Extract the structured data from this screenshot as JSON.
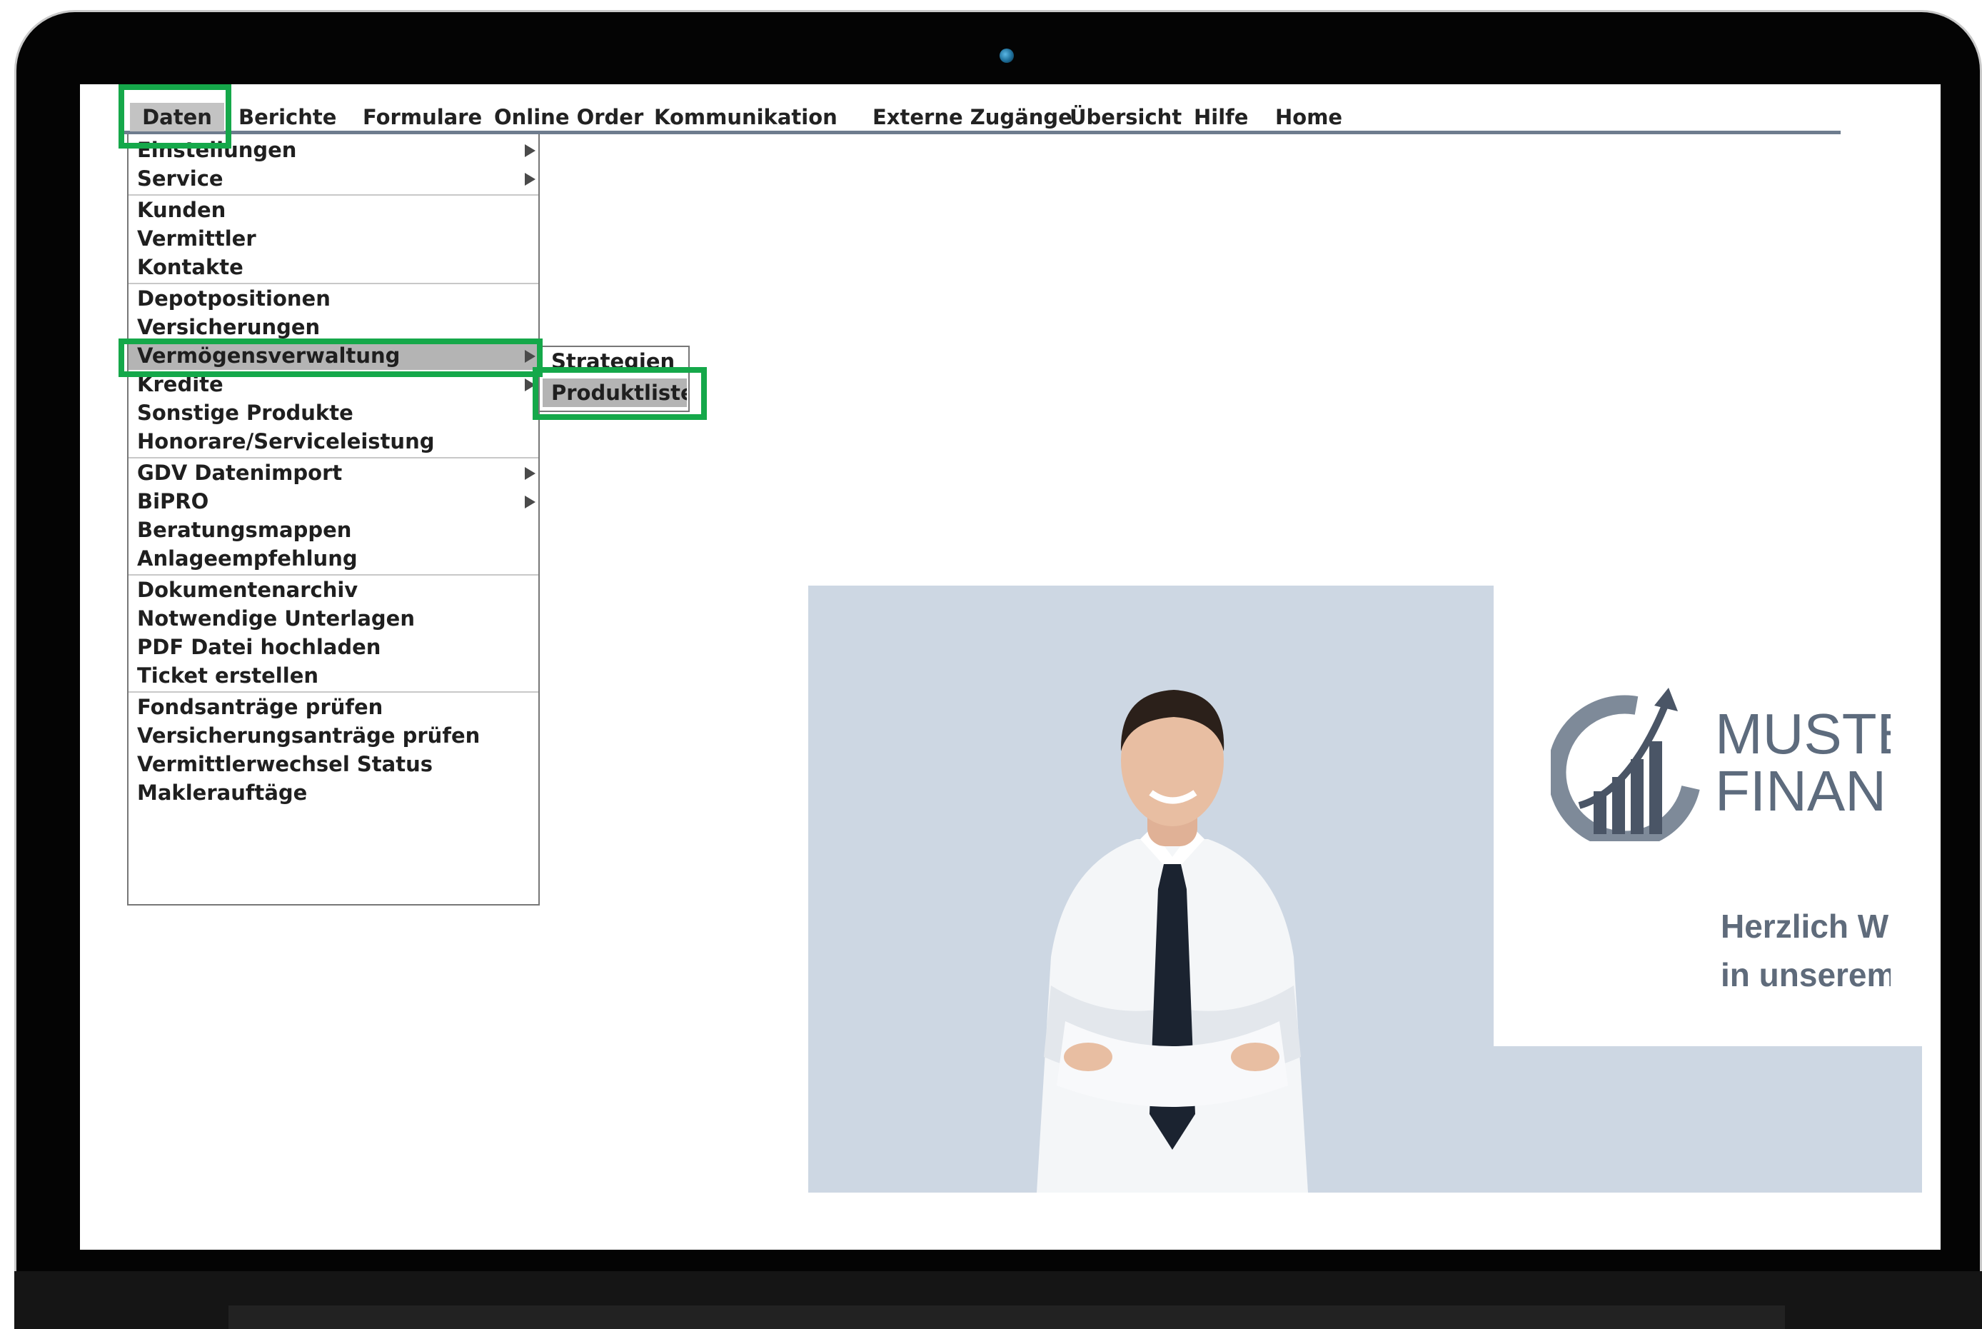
{
  "menubar": {
    "items": [
      "Daten",
      "Berichte",
      "Formulare",
      "Online Order",
      "Kommunikation",
      "Externe Zugänge",
      "Übersicht",
      "Hilfe",
      "Home"
    ]
  },
  "dropdown": {
    "items": [
      "Einstellungen",
      "Service",
      "Kunden",
      "Vermittler",
      "Kontakte",
      "Depotpositionen",
      "Versicherungen",
      "Vermögensverwaltung",
      "Kredite",
      "Sonstige Produkte",
      "Honorare/Serviceleistung",
      "GDV Datenimport",
      "BiPRO",
      "Beratungsmappen",
      "Anlageempfehlung",
      "Dokumentenarchiv",
      "Notwendige Unterlagen",
      "PDF Datei hochladen",
      "Ticket erstellen",
      "Fondsanträge prüfen",
      "Versicherungsanträge prüfen",
      "Vermittlerwechsel Status",
      "Maklerauftäge"
    ]
  },
  "submenu": {
    "items": [
      "Strategien",
      "Produktliste"
    ]
  },
  "hero": {
    "logo_line1": "MUSTE",
    "logo_line2": "FINAN",
    "welcome_line1": "Herzlich W",
    "welcome_line2": "in unserem"
  },
  "colors": {
    "highlight_green": "#15a84a",
    "menu_highlight": "#b4b4b4",
    "menubar_rule": "#6e7c8e",
    "hero_background": "#cdd7e3",
    "text_dark": "#222222"
  },
  "icons": {
    "submenu_arrow": "triangle-right-icon",
    "logo": "rising-chart-logo-icon"
  }
}
